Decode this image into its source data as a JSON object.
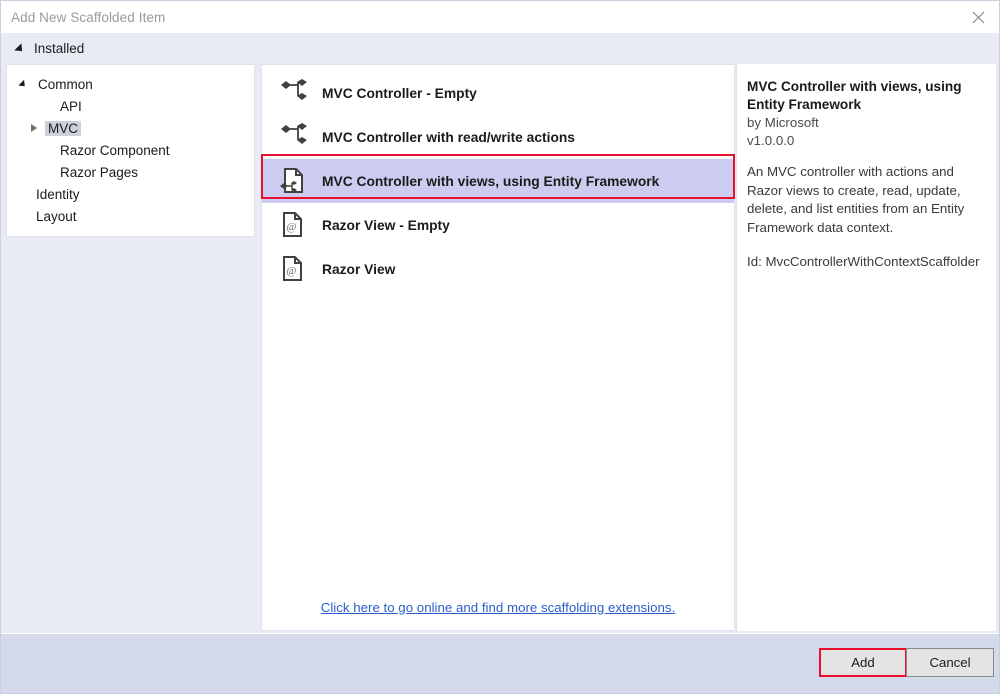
{
  "window": {
    "title": "Add New Scaffolded Item",
    "close_icon": "close-icon"
  },
  "installed": {
    "label": "Installed",
    "expand_icon": "triangle-down-icon"
  },
  "tree": {
    "items": [
      {
        "label": "Common",
        "level": 0,
        "arrow": "open",
        "selected": false
      },
      {
        "label": "API",
        "level": 1,
        "arrow": "none",
        "selected": false
      },
      {
        "label": "MVC",
        "level": 1,
        "arrow": "closed",
        "selected": true
      },
      {
        "label": "Razor Component",
        "level": 1,
        "arrow": "none",
        "selected": false
      },
      {
        "label": "Razor Pages",
        "level": 1,
        "arrow": "none",
        "selected": false
      },
      {
        "label": "Identity",
        "level": 0,
        "arrow": "none",
        "selected": false
      },
      {
        "label": "Layout",
        "level": 0,
        "arrow": "none",
        "selected": false
      }
    ]
  },
  "list": {
    "items": [
      {
        "label": "MVC Controller - Empty",
        "icon": "controller-node-icon",
        "selected": false
      },
      {
        "label": "MVC Controller with read/write actions",
        "icon": "controller-node-icon",
        "selected": false
      },
      {
        "label": "MVC Controller with views, using Entity Framework",
        "icon": "controller-document-node-icon",
        "selected": true
      },
      {
        "label": "Razor View - Empty",
        "icon": "razor-view-document-icon",
        "selected": false
      },
      {
        "label": "Razor View",
        "icon": "razor-view-document-icon",
        "selected": false
      }
    ],
    "more_link": "Click here to go online and find more scaffolding extensions."
  },
  "detail": {
    "title": "MVC Controller with views, using Entity Framework",
    "author": "by Microsoft",
    "version": "v1.0.0.0",
    "description": "An MVC controller with actions and Razor views to create, read, update, delete, and list entities from an Entity Framework data context.",
    "id": "Id: MvcControllerWithContextScaffolder"
  },
  "footer": {
    "add_label": "Add",
    "cancel_label": "Cancel"
  },
  "colors": {
    "dialog_bg": "#e8ebf4",
    "footer_bg": "#d4daea",
    "selection_highlight": "#ccccf0",
    "annotation_red": "#e8112d",
    "link_blue": "#2a60c8",
    "tree_selection": "#cdd0da"
  }
}
